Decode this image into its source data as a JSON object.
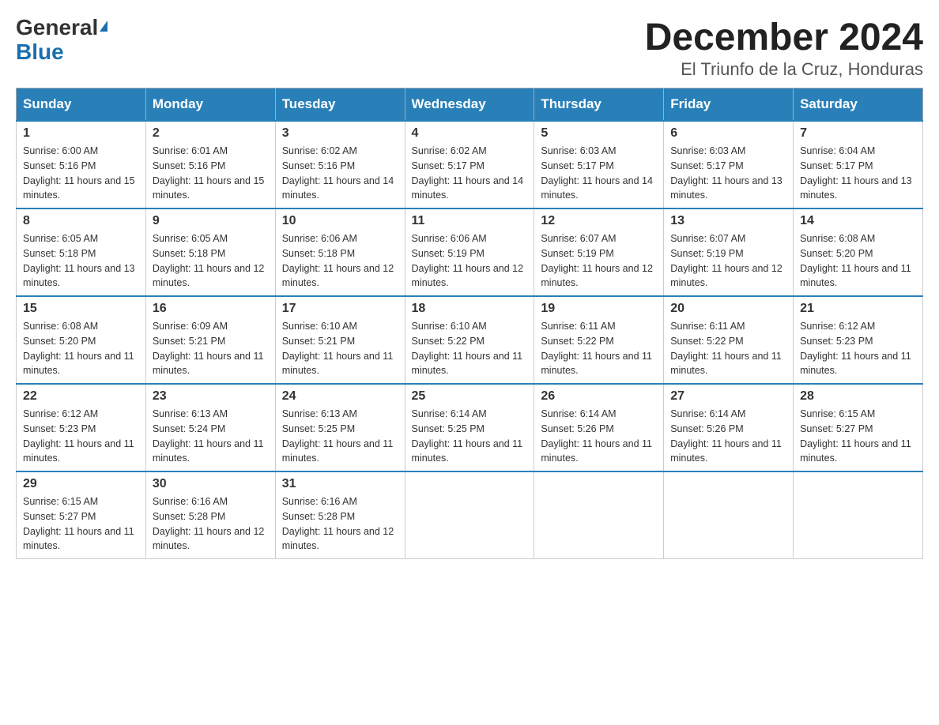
{
  "header": {
    "logo_general": "General",
    "logo_blue": "Blue",
    "main_title": "December 2024",
    "subtitle": "El Triunfo de la Cruz, Honduras"
  },
  "days_of_week": [
    "Sunday",
    "Monday",
    "Tuesday",
    "Wednesday",
    "Thursday",
    "Friday",
    "Saturday"
  ],
  "weeks": [
    [
      {
        "day": "1",
        "sunrise": "6:00 AM",
        "sunset": "5:16 PM",
        "daylight": "11 hours and 15 minutes."
      },
      {
        "day": "2",
        "sunrise": "6:01 AM",
        "sunset": "5:16 PM",
        "daylight": "11 hours and 15 minutes."
      },
      {
        "day": "3",
        "sunrise": "6:02 AM",
        "sunset": "5:16 PM",
        "daylight": "11 hours and 14 minutes."
      },
      {
        "day": "4",
        "sunrise": "6:02 AM",
        "sunset": "5:17 PM",
        "daylight": "11 hours and 14 minutes."
      },
      {
        "day": "5",
        "sunrise": "6:03 AM",
        "sunset": "5:17 PM",
        "daylight": "11 hours and 14 minutes."
      },
      {
        "day": "6",
        "sunrise": "6:03 AM",
        "sunset": "5:17 PM",
        "daylight": "11 hours and 13 minutes."
      },
      {
        "day": "7",
        "sunrise": "6:04 AM",
        "sunset": "5:17 PM",
        "daylight": "11 hours and 13 minutes."
      }
    ],
    [
      {
        "day": "8",
        "sunrise": "6:05 AM",
        "sunset": "5:18 PM",
        "daylight": "11 hours and 13 minutes."
      },
      {
        "day": "9",
        "sunrise": "6:05 AM",
        "sunset": "5:18 PM",
        "daylight": "11 hours and 12 minutes."
      },
      {
        "day": "10",
        "sunrise": "6:06 AM",
        "sunset": "5:18 PM",
        "daylight": "11 hours and 12 minutes."
      },
      {
        "day": "11",
        "sunrise": "6:06 AM",
        "sunset": "5:19 PM",
        "daylight": "11 hours and 12 minutes."
      },
      {
        "day": "12",
        "sunrise": "6:07 AM",
        "sunset": "5:19 PM",
        "daylight": "11 hours and 12 minutes."
      },
      {
        "day": "13",
        "sunrise": "6:07 AM",
        "sunset": "5:19 PM",
        "daylight": "11 hours and 12 minutes."
      },
      {
        "day": "14",
        "sunrise": "6:08 AM",
        "sunset": "5:20 PM",
        "daylight": "11 hours and 11 minutes."
      }
    ],
    [
      {
        "day": "15",
        "sunrise": "6:08 AM",
        "sunset": "5:20 PM",
        "daylight": "11 hours and 11 minutes."
      },
      {
        "day": "16",
        "sunrise": "6:09 AM",
        "sunset": "5:21 PM",
        "daylight": "11 hours and 11 minutes."
      },
      {
        "day": "17",
        "sunrise": "6:10 AM",
        "sunset": "5:21 PM",
        "daylight": "11 hours and 11 minutes."
      },
      {
        "day": "18",
        "sunrise": "6:10 AM",
        "sunset": "5:22 PM",
        "daylight": "11 hours and 11 minutes."
      },
      {
        "day": "19",
        "sunrise": "6:11 AM",
        "sunset": "5:22 PM",
        "daylight": "11 hours and 11 minutes."
      },
      {
        "day": "20",
        "sunrise": "6:11 AM",
        "sunset": "5:22 PM",
        "daylight": "11 hours and 11 minutes."
      },
      {
        "day": "21",
        "sunrise": "6:12 AM",
        "sunset": "5:23 PM",
        "daylight": "11 hours and 11 minutes."
      }
    ],
    [
      {
        "day": "22",
        "sunrise": "6:12 AM",
        "sunset": "5:23 PM",
        "daylight": "11 hours and 11 minutes."
      },
      {
        "day": "23",
        "sunrise": "6:13 AM",
        "sunset": "5:24 PM",
        "daylight": "11 hours and 11 minutes."
      },
      {
        "day": "24",
        "sunrise": "6:13 AM",
        "sunset": "5:25 PM",
        "daylight": "11 hours and 11 minutes."
      },
      {
        "day": "25",
        "sunrise": "6:14 AM",
        "sunset": "5:25 PM",
        "daylight": "11 hours and 11 minutes."
      },
      {
        "day": "26",
        "sunrise": "6:14 AM",
        "sunset": "5:26 PM",
        "daylight": "11 hours and 11 minutes."
      },
      {
        "day": "27",
        "sunrise": "6:14 AM",
        "sunset": "5:26 PM",
        "daylight": "11 hours and 11 minutes."
      },
      {
        "day": "28",
        "sunrise": "6:15 AM",
        "sunset": "5:27 PM",
        "daylight": "11 hours and 11 minutes."
      }
    ],
    [
      {
        "day": "29",
        "sunrise": "6:15 AM",
        "sunset": "5:27 PM",
        "daylight": "11 hours and 11 minutes."
      },
      {
        "day": "30",
        "sunrise": "6:16 AM",
        "sunset": "5:28 PM",
        "daylight": "11 hours and 12 minutes."
      },
      {
        "day": "31",
        "sunrise": "6:16 AM",
        "sunset": "5:28 PM",
        "daylight": "11 hours and 12 minutes."
      },
      null,
      null,
      null,
      null
    ]
  ]
}
